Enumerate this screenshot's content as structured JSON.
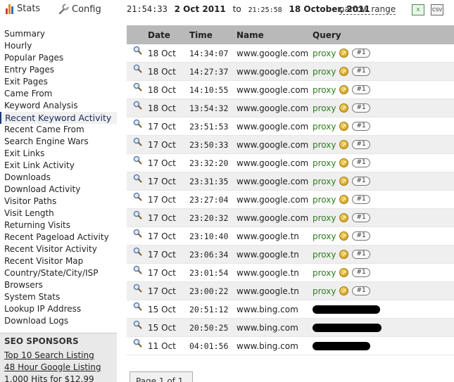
{
  "header": {
    "stats_label": "Stats",
    "config_label": "Config",
    "from_time": "21:54:33",
    "from_date": "2 Oct 2011",
    "to_label": "to",
    "to_time": "21:25:58",
    "to_date": "18 October, 2011",
    "narrow_range_label": "narrow range",
    "excel_icon": "excel-export-icon",
    "csv_label": "CSV",
    "stats_icon_colors": [
      "#d23b2b",
      "#e08a1e",
      "#2e6fc0"
    ]
  },
  "sidebar": {
    "items": [
      {
        "label": "Summary",
        "active": false
      },
      {
        "label": "Hourly",
        "active": false
      },
      {
        "label": "Popular Pages",
        "active": false
      },
      {
        "label": "Entry Pages",
        "active": false
      },
      {
        "label": "Exit Pages",
        "active": false
      },
      {
        "label": "Came From",
        "active": false
      },
      {
        "label": "Keyword Analysis",
        "active": false
      },
      {
        "label": "Recent Keyword Activity",
        "active": true
      },
      {
        "label": "Recent Came From",
        "active": false
      },
      {
        "label": "Search Engine Wars",
        "active": false
      },
      {
        "label": "Exit Links",
        "active": false
      },
      {
        "label": "Exit Link Activity",
        "active": false
      },
      {
        "label": "Downloads",
        "active": false
      },
      {
        "label": "Download Activity",
        "active": false
      },
      {
        "label": "Visitor Paths",
        "active": false
      },
      {
        "label": "Visit Length",
        "active": false
      },
      {
        "label": "Returning Visits",
        "active": false
      },
      {
        "label": "Recent Pageload Activity",
        "active": false
      },
      {
        "label": "Recent Visitor Activity",
        "active": false
      },
      {
        "label": "Recent Visitor Map",
        "active": false
      },
      {
        "label": "Country/State/City/ISP",
        "active": false
      },
      {
        "label": "Browsers",
        "active": false
      },
      {
        "label": "System Stats",
        "active": false
      },
      {
        "label": "Lookup IP Address",
        "active": false
      },
      {
        "label": "Download Logs",
        "active": false
      }
    ],
    "sponsors": {
      "title": "SEO SPONSORS",
      "links": [
        "Top 10 Search Listing",
        "48 Hour Google Listing",
        "1,000 Hits for $12.99"
      ]
    }
  },
  "table": {
    "columns": [
      "Date",
      "Time",
      "Name",
      "Query"
    ],
    "rows": [
      {
        "date": "18 Oct",
        "time": "14:34:07",
        "name": "www.google.com",
        "query": "proxy",
        "badge": "#1",
        "redacted": false
      },
      {
        "date": "18 Oct",
        "time": "14:27:37",
        "name": "www.google.com",
        "query": "proxy",
        "badge": "#1",
        "redacted": false
      },
      {
        "date": "18 Oct",
        "time": "14:10:55",
        "name": "www.google.com",
        "query": "proxy",
        "badge": "#1",
        "redacted": false
      },
      {
        "date": "18 Oct",
        "time": "13:54:32",
        "name": "www.google.com",
        "query": "proxy",
        "badge": "#1",
        "redacted": false
      },
      {
        "date": "17 Oct",
        "time": "23:51:53",
        "name": "www.google.com",
        "query": "proxy",
        "badge": "#1",
        "redacted": false
      },
      {
        "date": "17 Oct",
        "time": "23:50:33",
        "name": "www.google.com",
        "query": "proxy",
        "badge": "#1",
        "redacted": false
      },
      {
        "date": "17 Oct",
        "time": "23:32:20",
        "name": "www.google.com",
        "query": "proxy",
        "badge": "#1",
        "redacted": false
      },
      {
        "date": "17 Oct",
        "time": "23:31:35",
        "name": "www.google.com",
        "query": "proxy",
        "badge": "#1",
        "redacted": false
      },
      {
        "date": "17 Oct",
        "time": "23:27:04",
        "name": "www.google.com",
        "query": "proxy",
        "badge": "#1",
        "redacted": false
      },
      {
        "date": "17 Oct",
        "time": "23:20:32",
        "name": "www.google.com",
        "query": "proxy",
        "badge": "#1",
        "redacted": false
      },
      {
        "date": "17 Oct",
        "time": "23:10:40",
        "name": "www.google.tn",
        "query": "proxy",
        "badge": "#1",
        "redacted": false
      },
      {
        "date": "17 Oct",
        "time": "23:06:34",
        "name": "www.google.tn",
        "query": "proxy",
        "badge": "#1",
        "redacted": false
      },
      {
        "date": "17 Oct",
        "time": "23:01:54",
        "name": "www.google.tn",
        "query": "proxy",
        "badge": "#1",
        "redacted": false
      },
      {
        "date": "17 Oct",
        "time": "23:00:22",
        "name": "www.google.tn",
        "query": "proxy",
        "badge": "#1",
        "redacted": false
      },
      {
        "date": "15 Oct",
        "time": "20:51:12",
        "name": "www.bing.com",
        "query": "",
        "badge": "",
        "redacted": true
      },
      {
        "date": "15 Oct",
        "time": "20:50:25",
        "name": "www.bing.com",
        "query": "",
        "badge": "",
        "redacted": true
      },
      {
        "date": "11 Oct",
        "time": "04:01:56",
        "name": "www.bing.com",
        "query": "",
        "badge": "",
        "redacted": true
      }
    ]
  },
  "pager": {
    "label": "Page 1 of 1"
  },
  "colors": {
    "table_header_bg": "#b9b9b9",
    "row_alt_bg": "#efefef",
    "query_green": "#2e7d1e",
    "sponsor_bg": "#e9e9e9"
  }
}
